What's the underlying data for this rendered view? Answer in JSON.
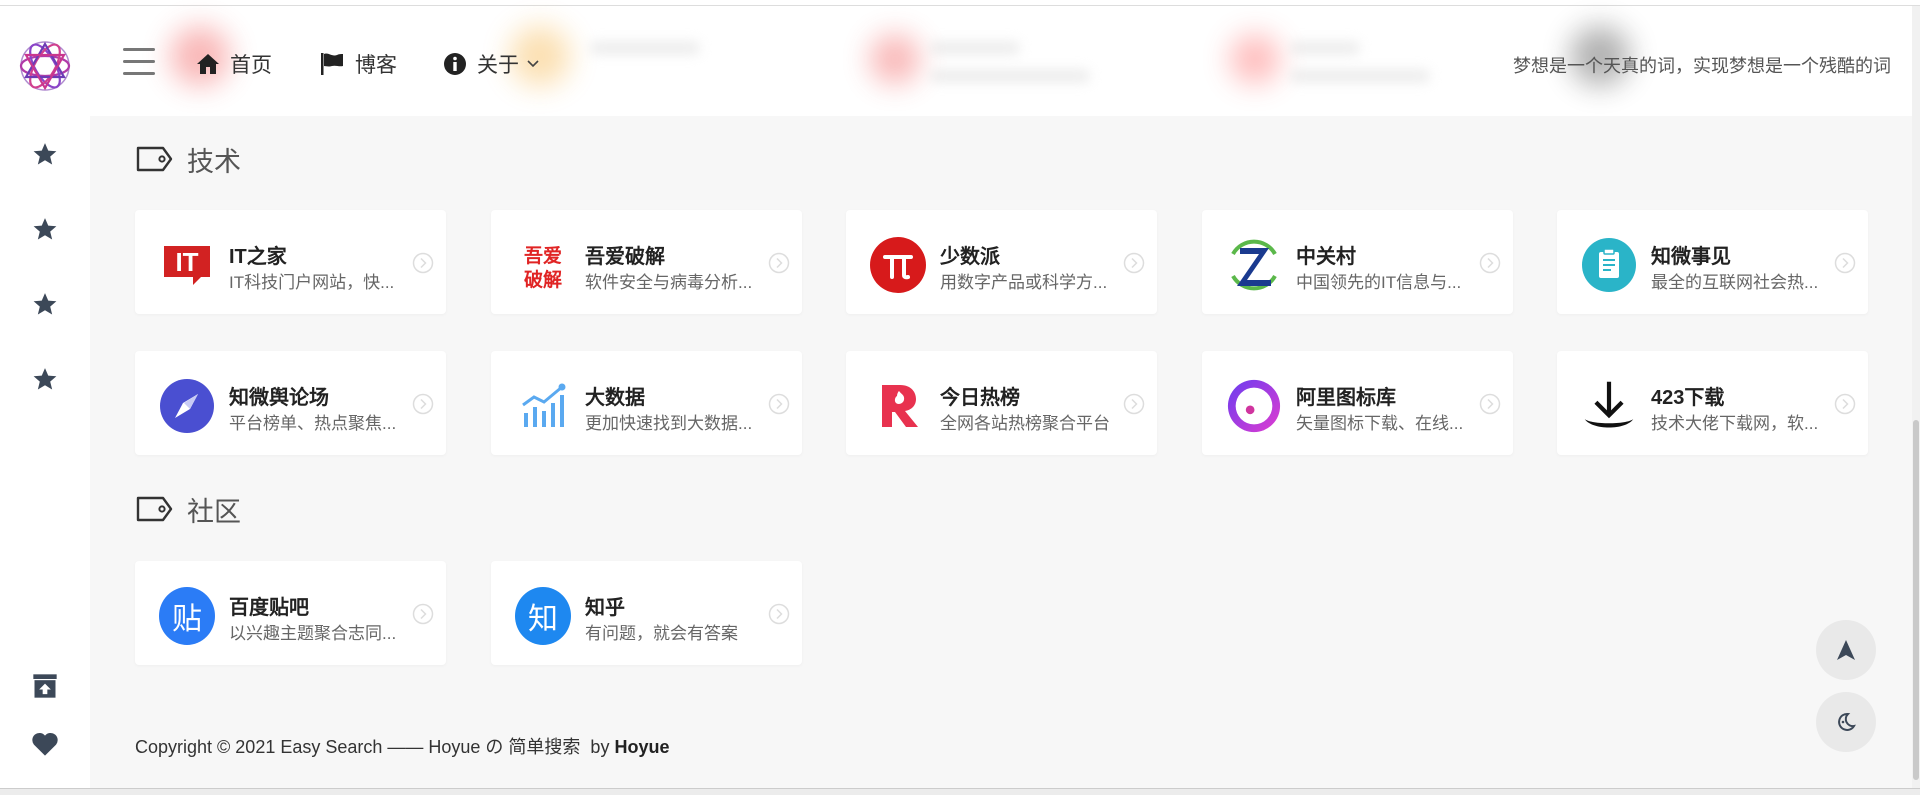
{
  "header": {
    "nav": [
      {
        "label": "首页",
        "icon": "home-icon"
      },
      {
        "label": "博客",
        "icon": "flag-icon"
      },
      {
        "label": "关于",
        "icon": "info-icon",
        "has_dropdown": true
      }
    ],
    "motto": "梦想是一个天真的词，实现梦想是一个残酷的词"
  },
  "sidebar": {
    "stars": [
      "star-icon",
      "star-icon",
      "star-icon",
      "star-icon"
    ],
    "bottom": [
      "archive-upload-icon",
      "heart-icon"
    ]
  },
  "sections": [
    {
      "title": "技术",
      "cards": [
        {
          "title": "IT之家",
          "desc": "IT科技门户网站，快...",
          "icon": "ithome-logo",
          "color": "#d22222"
        },
        {
          "title": "吾爱破解",
          "desc": "软件安全与病毒分析...",
          "icon": "52pojie-logo",
          "color": "#e02424"
        },
        {
          "title": "少数派",
          "desc": "用数字产品或科学方...",
          "icon": "sspai-logo",
          "color": "#d71a1b"
        },
        {
          "title": "中关村",
          "desc": "中国领先的IT信息与...",
          "icon": "zol-logo",
          "color": "#1a3a8f"
        },
        {
          "title": "知微事见",
          "desc": "最全的互联网社会热...",
          "icon": "zhiwei-logo",
          "color": "#2ab4c8"
        },
        {
          "title": "知微舆论场",
          "desc": "平台榜单、热点聚焦...",
          "icon": "compass-logo",
          "color": "#4a4fd1"
        },
        {
          "title": "大数据",
          "desc": "更加快速找到大数据...",
          "icon": "bigdata-chart-logo",
          "color": "#5aa9f0"
        },
        {
          "title": "今日热榜",
          "desc": "全网各站热榜聚合平台",
          "icon": "tophub-logo",
          "color": "#e8324f"
        },
        {
          "title": "阿里图标库",
          "desc": "矢量图标下载、在线...",
          "icon": "iconfont-logo",
          "color": "#8a2be2"
        },
        {
          "title": "423下载",
          "desc": "技术大佬下载网，软...",
          "icon": "download-logo",
          "color": "#111111"
        }
      ]
    },
    {
      "title": "社区",
      "cards": [
        {
          "title": "百度贴吧",
          "desc": "以兴趣主题聚合志同...",
          "icon": "tieba-logo",
          "glyph": "贴",
          "color": "#2b7cf6"
        },
        {
          "title": "知乎",
          "desc": "有问题，就会有答案",
          "icon": "zhihu-logo",
          "glyph": "知",
          "color": "#1e88f0"
        }
      ]
    }
  ],
  "logos": {
    "ithome": "IT",
    "pojie_top": "吾爱",
    "pojie_bottom": "破解"
  },
  "footer": {
    "text": "Copyright © 2021 Easy Search —— Hoyue の 简单搜索  by ",
    "author": "Hoyue"
  },
  "floating": [
    "back-to-top-icon",
    "dark-mode-icon"
  ]
}
